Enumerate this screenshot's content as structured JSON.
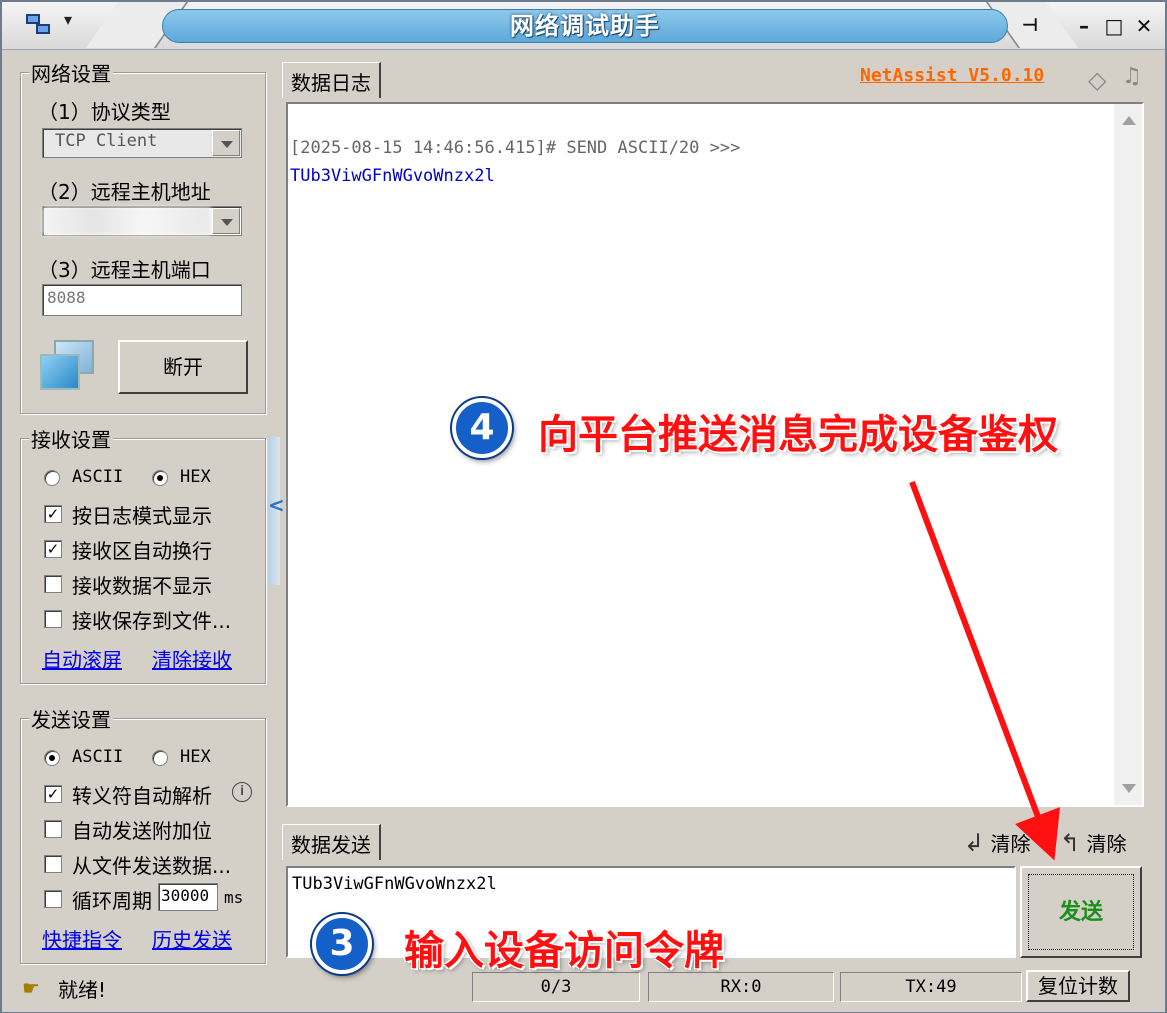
{
  "window": {
    "title": "网络调试助手",
    "controls": [
      "min",
      "max",
      "close"
    ]
  },
  "network_settings": {
    "group_title": "网络设置",
    "protocol_label": "（1）协议类型",
    "protocol_value": "TCP Client",
    "host_label": "（2）远程主机地址",
    "host_value": "",
    "port_label": "（3）远程主机端口",
    "port_value": "8088",
    "disconnect_button": "断开"
  },
  "receive_settings": {
    "group_title": "接收设置",
    "radio_ascii": "ASCII",
    "radio_hex": "HEX",
    "selected": "HEX",
    "options": [
      {
        "label": "按日志模式显示",
        "checked": true
      },
      {
        "label": "接收区自动换行",
        "checked": true
      },
      {
        "label": "接收数据不显示",
        "checked": false
      },
      {
        "label": "接收保存到文件...",
        "checked": false
      }
    ],
    "link_autoscroll": "自动滚屏",
    "link_clear": "清除接收"
  },
  "send_settings": {
    "group_title": "发送设置",
    "radio_ascii": "ASCII",
    "radio_hex": "HEX",
    "selected": "ASCII",
    "options": [
      {
        "label": "转义符自动解析",
        "checked": true
      },
      {
        "label": "自动发送附加位",
        "checked": false
      },
      {
        "label": "从文件发送数据...",
        "checked": false
      },
      {
        "label": "循环周期",
        "checked": false
      }
    ],
    "cycle_value": "30000",
    "cycle_unit": "ms",
    "link_shortcut": "快捷指令",
    "link_history": "历史发送"
  },
  "log": {
    "tab_label": "数据日志",
    "brand_link": "NetAssist V5.0.10",
    "entries": [
      {
        "header": "[2025-08-15 14:46:56.415]# SEND ASCII/20 >>>",
        "content": "TUb3ViwGFnWGvoWnzx2l"
      }
    ]
  },
  "send": {
    "tab_label": "数据发送",
    "clear_label_1": "清除",
    "clear_label_2": "清除",
    "input_value": "TUb3ViwGFnWGvoWnzx2l",
    "send_button": "发送"
  },
  "status": {
    "text": "就绪!",
    "count": "0/3",
    "rx": "RX:0",
    "tx": "TX:49",
    "reset_button": "复位计数"
  },
  "annotations": {
    "step4_number": "4",
    "step4_text": "向平台推送消息完成设备鉴权",
    "step3_number": "3",
    "step3_text": "输入设备访问令牌"
  },
  "colors": {
    "annotation_red": "#ff1010",
    "badge_blue": "#1560c8",
    "send_green": "#1b8e1b",
    "brand_orange": "#ff6600",
    "log_content_blue": "#0000cc"
  }
}
